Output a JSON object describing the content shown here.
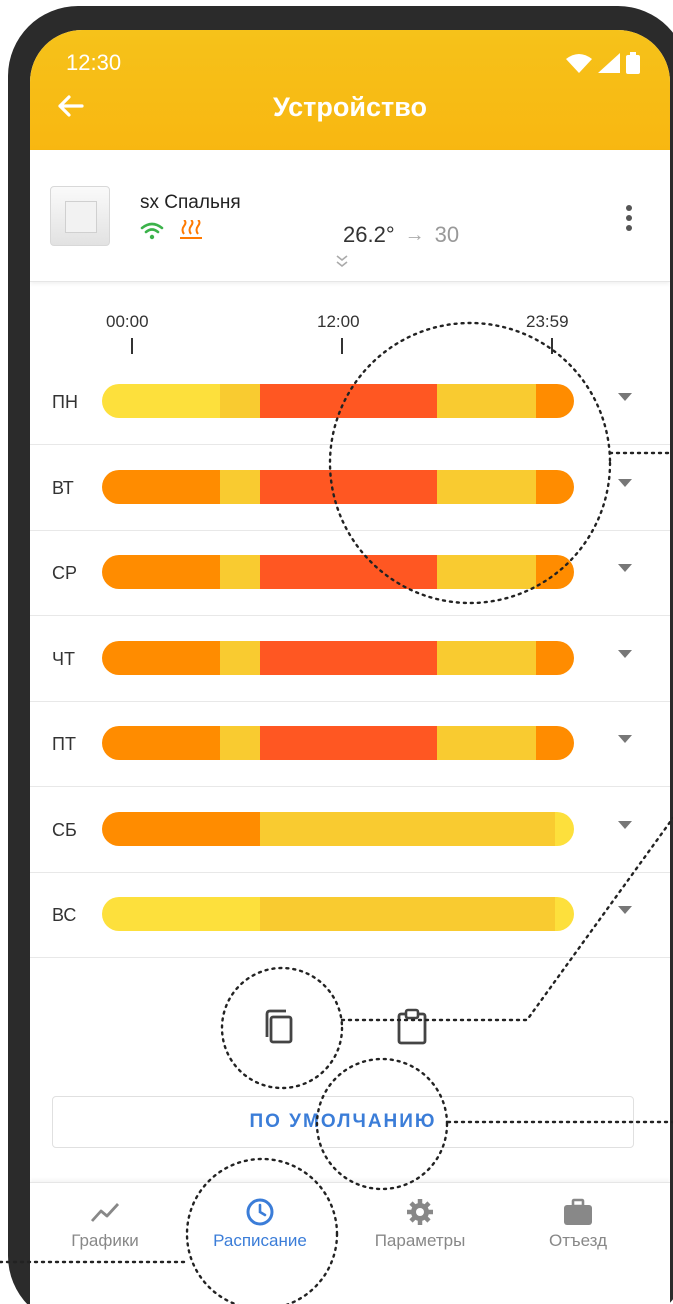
{
  "status": {
    "time": "12:30"
  },
  "header": {
    "title": "Устройство"
  },
  "device": {
    "name": "sx Спальня",
    "current_temp": "26.2°",
    "arrow": "→",
    "target_temp": "30"
  },
  "timeline": {
    "start": "00:00",
    "mid": "12:00",
    "end": "23:59"
  },
  "colors": {
    "accent": "#f8b711",
    "c1": "#fde03c",
    "c2": "#f9cb30",
    "c3": "#ff5722",
    "c4": "#ff8c00",
    "link": "#3b7dd8"
  },
  "schedule": [
    {
      "day": "ПН",
      "segments": [
        [
          "c1",
          25
        ],
        [
          "c2",
          8.5
        ],
        [
          "c3",
          37.5
        ],
        [
          "c2",
          21
        ],
        [
          "c4",
          8
        ]
      ]
    },
    {
      "day": "ВТ",
      "segments": [
        [
          "c4",
          25
        ],
        [
          "c2",
          8.5
        ],
        [
          "c3",
          37.5
        ],
        [
          "c2",
          21
        ],
        [
          "c4",
          8
        ]
      ]
    },
    {
      "day": "СР",
      "segments": [
        [
          "c4",
          25
        ],
        [
          "c2",
          8.5
        ],
        [
          "c3",
          37.5
        ],
        [
          "c2",
          21
        ],
        [
          "c4",
          8
        ]
      ]
    },
    {
      "day": "ЧТ",
      "segments": [
        [
          "c4",
          25
        ],
        [
          "c2",
          8.5
        ],
        [
          "c3",
          37.5
        ],
        [
          "c2",
          21
        ],
        [
          "c4",
          8
        ]
      ]
    },
    {
      "day": "ПТ",
      "segments": [
        [
          "c4",
          25
        ],
        [
          "c2",
          8.5
        ],
        [
          "c3",
          37.5
        ],
        [
          "c2",
          21
        ],
        [
          "c4",
          8
        ]
      ]
    },
    {
      "day": "СБ",
      "segments": [
        [
          "c4",
          33.5
        ],
        [
          "c2",
          62.5
        ],
        [
          "c1",
          4
        ]
      ]
    },
    {
      "day": "ВС",
      "segments": [
        [
          "c1",
          33.5
        ],
        [
          "c2",
          62.5
        ],
        [
          "c1",
          4
        ]
      ]
    }
  ],
  "actions": {
    "default_label": "ПО УМОЛЧАНИЮ"
  },
  "nav": [
    {
      "label": "Графики"
    },
    {
      "label": "Расписание"
    },
    {
      "label": "Параметры"
    },
    {
      "label": "Отъезд"
    }
  ]
}
